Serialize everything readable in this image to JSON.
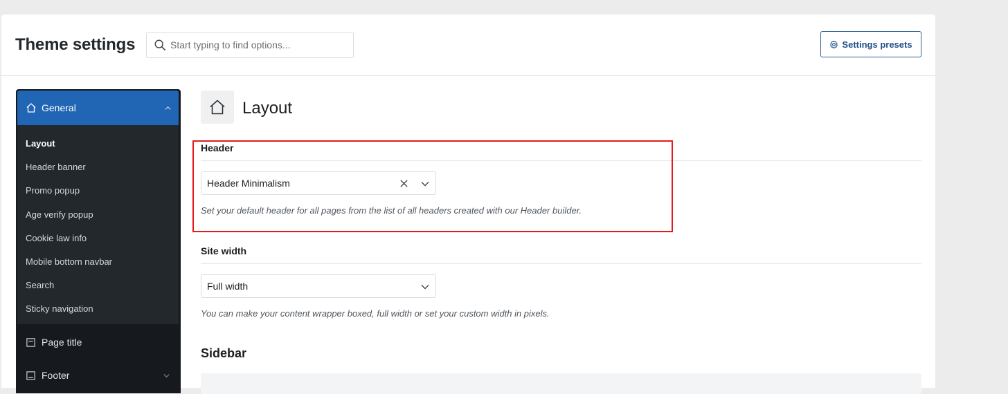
{
  "header": {
    "title": "Theme settings",
    "search_placeholder": "Start typing to find options...",
    "presets_label": "Settings presets"
  },
  "sidebar": {
    "active_group": {
      "label": "General",
      "icon": "home-icon",
      "items": [
        {
          "label": "Layout",
          "active": true
        },
        {
          "label": "Header banner"
        },
        {
          "label": "Promo popup"
        },
        {
          "label": "Age verify popup"
        },
        {
          "label": "Cookie law info"
        },
        {
          "label": "Mobile bottom navbar"
        },
        {
          "label": "Search"
        },
        {
          "label": "Sticky navigation"
        }
      ]
    },
    "groups": [
      {
        "label": "Page title",
        "icon": "page-icon"
      },
      {
        "label": "Footer",
        "icon": "footer-icon"
      }
    ]
  },
  "content": {
    "section_title": "Layout",
    "section_icon": "home-icon",
    "header_field": {
      "label": "Header",
      "value": "Header Minimalism",
      "description": "Set your default header for all pages from the list of all headers created with our Header builder."
    },
    "site_width_field": {
      "label": "Site width",
      "value": "Full width",
      "description": "You can make your content wrapper boxed, full width or set your custom width in pixels."
    },
    "sidebar_heading": "Sidebar"
  },
  "colors": {
    "accent": "#2165b5",
    "sidebar_bg": "#23282d",
    "highlight": "#e41b1b"
  }
}
